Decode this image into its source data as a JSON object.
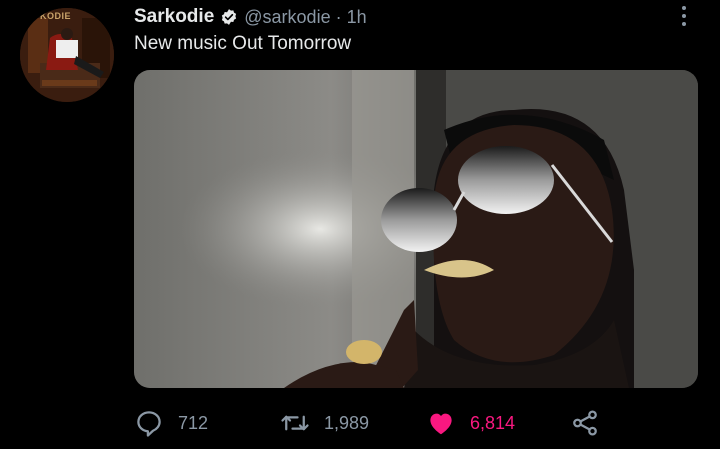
{
  "tweet": {
    "author_name": "Sarkodie",
    "handle": "@sarkodie",
    "separator": "·",
    "time": "1h",
    "text": "New music Out Tomorrow",
    "avatar_logo_text": "KODIE"
  },
  "actions": {
    "replies": "712",
    "retweets": "1,989",
    "likes": "6,814",
    "liked": true
  },
  "colors": {
    "background": "#000000",
    "text": "#e7e9ea",
    "muted": "#8b98a5",
    "like": "#f91880"
  },
  "icons": [
    "verified-badge-icon",
    "more-icon",
    "reply-icon",
    "retweet-icon",
    "heart-icon",
    "share-icon"
  ]
}
